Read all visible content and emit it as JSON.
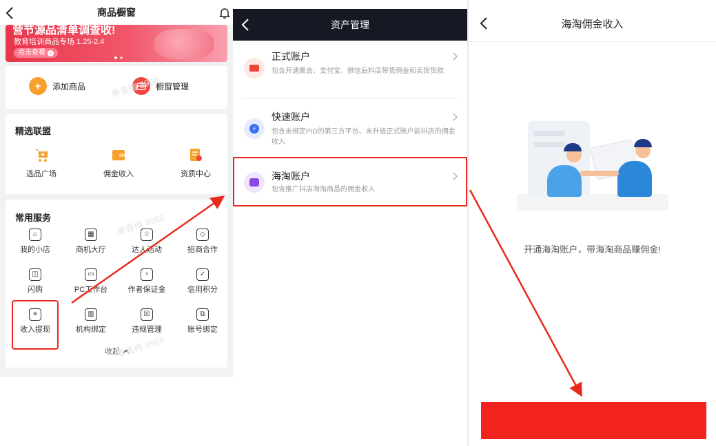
{
  "panel1": {
    "title": "商品橱窗",
    "banner": {
      "headline": "营节源品清单调查收!",
      "sub": "教育培训商品专场 1.25-2.4",
      "button": "点击查看"
    },
    "actions": [
      {
        "label": "添加商品",
        "icon": "plus-box-icon"
      },
      {
        "label": "橱窗管理",
        "icon": "store-icon"
      }
    ],
    "alliance": {
      "title": "精选联盟",
      "items": [
        {
          "label": "选品广场",
          "icon": "cart-icon"
        },
        {
          "label": "佣金收入",
          "icon": "wallet-icon"
        },
        {
          "label": "资质中心",
          "icon": "certificate-icon"
        }
      ]
    },
    "services": {
      "title": "常用服务",
      "items": [
        {
          "label": "我的小店",
          "icon": "shop-icon"
        },
        {
          "label": "商机大厅",
          "icon": "opportunity-icon"
        },
        {
          "label": "达人活动",
          "icon": "event-icon"
        },
        {
          "label": "招商合作",
          "icon": "handshake-icon"
        },
        {
          "label": "闪购",
          "icon": "flash-bag-icon"
        },
        {
          "label": "PC工作台",
          "icon": "monitor-icon"
        },
        {
          "label": "作者保证金",
          "icon": "deposit-icon"
        },
        {
          "label": "信用积分",
          "icon": "shield-check-icon"
        },
        {
          "label": "收入提现",
          "icon": "withdraw-icon"
        },
        {
          "label": "机构绑定",
          "icon": "building-icon"
        },
        {
          "label": "违规管理",
          "icon": "violation-icon"
        },
        {
          "label": "账号绑定",
          "icon": "link-account-icon"
        }
      ],
      "collapse": "收起"
    },
    "watermark": "拳香梅 8966"
  },
  "panel2": {
    "title": "资产管理",
    "accounts": [
      {
        "title": "正式账户",
        "desc": "包含开通聚合、支付宝、微信后抖店带货佣金和卖货货款",
        "color": "#f0453d"
      },
      {
        "title": "快速账户",
        "desc": "包含未绑定PID的第三方平台、未升级正式账户前抖店的佣金收入",
        "color": "#3d6df0"
      },
      {
        "title": "海淘账户",
        "desc": "包含推广抖店海淘商品的佣金收入",
        "color": "#8a47e6"
      }
    ]
  },
  "panel3": {
    "title": "海淘佣金收入",
    "empty_text": "开通海淘账户，带海淘商品赚佣金!"
  },
  "colors": {
    "highlight": "#e8291c",
    "accent_orange": "#f7a02c",
    "accent_red": "#f0453d",
    "redact": "#f2231f"
  }
}
